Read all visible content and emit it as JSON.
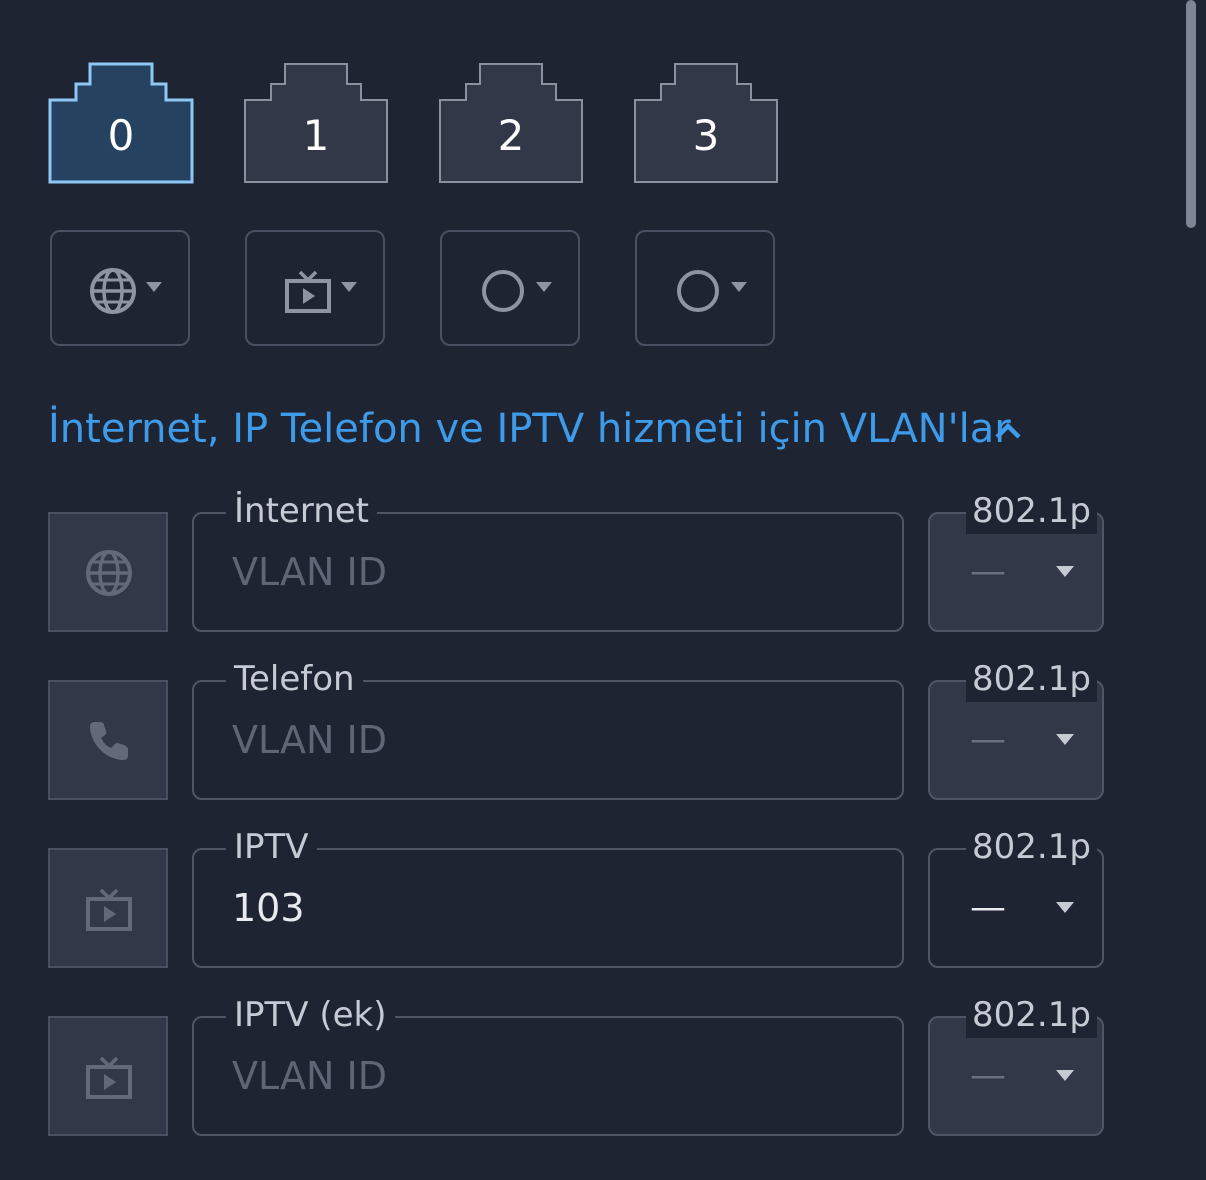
{
  "ports": [
    {
      "label": "0",
      "selected": true
    },
    {
      "label": "1",
      "selected": false
    },
    {
      "label": "2",
      "selected": false
    },
    {
      "label": "3",
      "selected": false
    }
  ],
  "port_modes": [
    {
      "icon": "globe-icon"
    },
    {
      "icon": "tv-icon"
    },
    {
      "icon": "circle-icon"
    },
    {
      "icon": "circle-icon"
    }
  ],
  "section": {
    "title": "İnternet, IP Telefon ve IPTV hizmeti için VLAN'lar",
    "expanded": true
  },
  "vlans": [
    {
      "service": "İnternet",
      "icon": "globe-icon",
      "placeholder": "VLAN ID",
      "value": "",
      "priority_label": "802.1p",
      "priority_value": "—"
    },
    {
      "service": "Telefon",
      "icon": "phone-icon",
      "placeholder": "VLAN ID",
      "value": "",
      "priority_label": "802.1p",
      "priority_value": "—"
    },
    {
      "service": "IPTV",
      "icon": "tv-icon",
      "placeholder": "VLAN ID",
      "value": "103",
      "priority_label": "802.1p",
      "priority_value": "—"
    },
    {
      "service": "IPTV (ek)",
      "icon": "tv-icon",
      "placeholder": "VLAN ID",
      "value": "",
      "priority_label": "802.1p",
      "priority_value": "—"
    }
  ],
  "colors": {
    "background": "#1f2433",
    "accent": "#3d9be9",
    "port_selected_fill": "#264261",
    "port_selected_border": "#8ec6f4",
    "port_fill": "#323847",
    "border": "#4f5565"
  }
}
